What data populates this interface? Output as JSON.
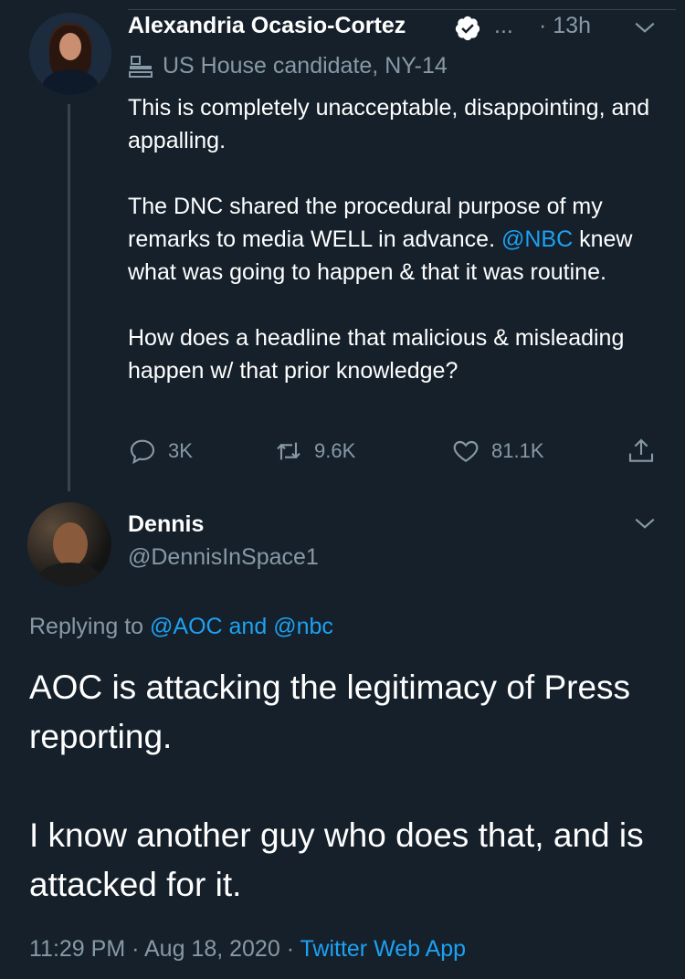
{
  "tweet": {
    "author_name": "Alexandria Ocasio-Cortez",
    "verified_icon": "verified-badge-icon",
    "ellipsis": "...",
    "time": "· 13h",
    "label": "US House candidate, NY-14",
    "paragraph1": "This is completely unacceptable, disappointing, and appalling.",
    "paragraph2_mention": "@NBC",
    "paragraph2_pre": "The DNC shared the procedural purpose of my remarks to media WELL in advance. ",
    "paragraph2_post": " knew what was going to happen & that it was routine.",
    "paragraph3": "How does a headline that malicious & misleading happen w/ that prior knowledge?",
    "replies": "3K",
    "retweets": "9.6K",
    "likes": "81.1K"
  },
  "reply": {
    "author_name": "Dennis",
    "handle": "@DennisInSpace1",
    "replying_prefix": "Replying to ",
    "replying_mentions": "@AOC and @nbc",
    "paragraph1": "AOC is attacking the legitimacy of Press reporting.",
    "paragraph2": "I know another guy who does that, and is attacked for it.",
    "time": "11:29 PM",
    "separator1": " · ",
    "date": "Aug 18, 2020",
    "separator2": " · ",
    "app": "Twitter Web App"
  },
  "colors": {
    "background": "#15202b",
    "text": "#ffffff",
    "muted": "#8899a6",
    "accent": "#1da1f2"
  }
}
